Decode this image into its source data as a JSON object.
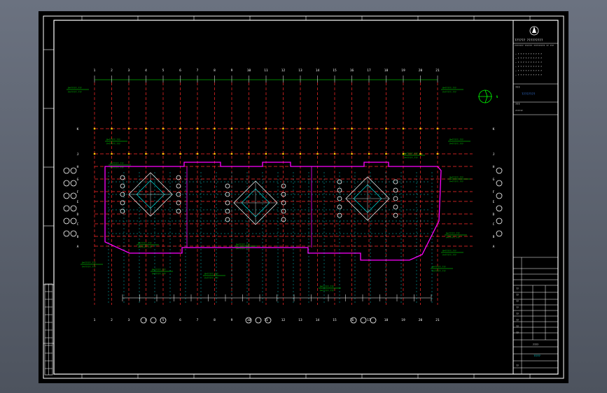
{
  "drawing": {
    "title_block": {
      "company_line": "?????? ?????????",
      "company_sub": "??????? ?????? ????????? ?? ???",
      "item_label": "???",
      "project_name": "????????",
      "drawing_label": "???",
      "scale_label": "??????",
      "approval_rows": [
        "??",
        "??",
        "??",
        "??",
        "??",
        "??",
        "??",
        "??"
      ],
      "project_code": "????",
      "sheet_label": "??",
      "footer_code": "?????"
    },
    "column_labels": [
      "1",
      "2",
      "3",
      "4",
      "5",
      "6",
      "7",
      "8",
      "9",
      "10",
      "11",
      "12",
      "13",
      "14",
      "15",
      "16",
      "17",
      "18",
      "19",
      "20",
      "21"
    ],
    "row_labels": [
      "K",
      "J",
      "H",
      "G",
      "F",
      "E",
      "D",
      "C",
      "B",
      "A"
    ],
    "north_arrow": "N",
    "colors": {
      "background": "#000000",
      "frame": "#ffffff",
      "axis": "#ff2a2a",
      "outline": "#ff00ff",
      "annotation": "#00ff00",
      "grid": "#00ffff",
      "accent_yellow": "#ffcc00",
      "blue_text": "#3b82f6"
    }
  }
}
